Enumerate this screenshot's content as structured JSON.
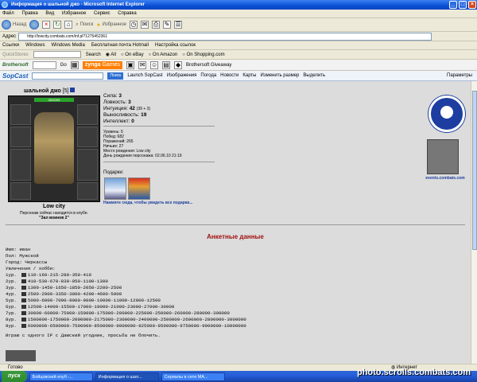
{
  "window": {
    "title": "Информация о шальной джо - Microsoft Internet Explorer"
  },
  "menu": [
    "Файл",
    "Правка",
    "Вид",
    "Избранное",
    "Сервис",
    "Справка"
  ],
  "toolbar": {
    "back": "Назад",
    "search": "Поиск",
    "favorites": "Избранное"
  },
  "address": {
    "label": "Адрес",
    "url": "http://lowcity.combats.com/inf.pl?1275452361"
  },
  "links": {
    "label": "Ссылки",
    "items": [
      "Windows",
      "Windows Media",
      "Бесплатная почта Hotmail",
      "Настройка ссылок"
    ]
  },
  "toolbar2": {
    "quickstores": "QuickStores",
    "search": "Search",
    "all": "All",
    "ebay": "On eBay",
    "amazon": "On Amazon",
    "shopping": "On Shopping.com"
  },
  "toolbar3": {
    "brand": "Brothersoft",
    "go": "Go",
    "zynga": "zynga",
    "games": "Games",
    "giveaway": "Brothersoft Giveaway"
  },
  "sopbar": {
    "logo": "SopCast",
    "search_btn": "Поиск",
    "launch": "Launch SopCast",
    "images": "Изображения",
    "weather": "Погода",
    "news": "Новости",
    "maps": "Карты",
    "resize": "Изменить размер",
    "highlight": "Выделить",
    "params": "Параметры"
  },
  "profile": {
    "name": "шальной джо",
    "tag": "[5]",
    "hp": "263/263",
    "stats": [
      {
        "label": "Сила:",
        "value": "3"
      },
      {
        "label": "Ловкость:",
        "value": "3"
      },
      {
        "label": "Интуиция:",
        "value": "42",
        "extra": "(39 + 3)"
      },
      {
        "label": "Выносливость:",
        "value": "19"
      },
      {
        "label": "Интеллект:",
        "value": "0"
      }
    ],
    "info": [
      "Уровень: 5",
      "Побед: 682",
      "Поражений: 265",
      "Ничьих: 27",
      "Место рождения: Low city",
      "День рождения персонажа: 02.06.10 21:19"
    ],
    "gifts_label": "Подарки:",
    "gifts_link": "Нажмите сюда, чтобы увидеть все подарки...",
    "location": "Low city",
    "location_note": "Персонаж сейчас находится в клубе.",
    "location_room": "\"Зал воинов 2\"",
    "events": "events.combats.com"
  },
  "anket": {
    "title": "Анкетные данные",
    "name": "Имя: иван",
    "sex": "Пол: Мужской",
    "city": "Город: Черкассы",
    "hobby": "Увлечения / хобби:",
    "levels": [
      {
        "lvl": "1ур.",
        "vals": "110-160-215-280-350-410"
      },
      {
        "lvl": "2ур.",
        "vals": "410-530-670-830-950-1100-1300"
      },
      {
        "lvl": "3ур.",
        "vals": "1300-1450-1650-1850-2050-2200-2500"
      },
      {
        "lvl": "4ур.",
        "vals": "2500-2900-3350-3800-4200-4600-5000"
      },
      {
        "lvl": "5ур.",
        "vals": "5000-6000-7000-8000-9000-10000-11000-12000-12500"
      },
      {
        "lvl": "6ур.",
        "vals": "12500-14000-15500-17000-19000-21000-23000-27000-30000"
      },
      {
        "lvl": "7ур.",
        "vals": "30000-60000-75000-150000-175000-200000-225000-250000-260000-280000-300000"
      },
      {
        "lvl": "8ур.",
        "vals": "1500000-1750000-2000000-2175000-2300000-2400000-2500000-2600000-2800000-3000000"
      },
      {
        "lvl": "9ур.",
        "vals": "6000000-6500000-7500000-8500000-9000000-925000-9500000-9750000-9900000-10000000"
      }
    ],
    "note": "Играю с одного IP с Дамский угодник, просьба не блочить."
  },
  "statusbar": {
    "ready": "Готово",
    "zone": "Интернет"
  },
  "taskbar": {
    "start": "пуск",
    "tasks": [
      "Бойцовский клуб -...",
      "Информация о шал...",
      "Сериалы в сети МА..."
    ]
  },
  "watermark": "photo.scrolls.combats.com"
}
